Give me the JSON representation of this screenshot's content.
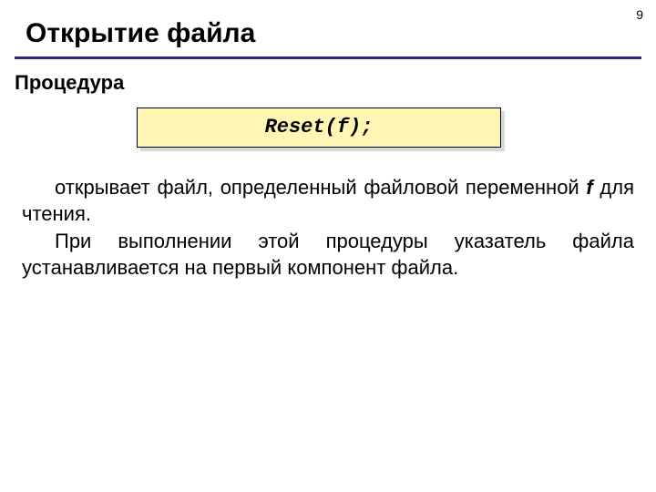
{
  "page_number": "9",
  "title": "Открытие файла",
  "subheading": "Процедура",
  "code": "Reset(f);",
  "body": {
    "p1_a": "открывает файл, определенный файловой переменной ",
    "p1_var": "f",
    "p1_b": " для чтения.",
    "p2": "При выполнении этой процедуры указатель файла устанавливается на первый компонент файла."
  }
}
